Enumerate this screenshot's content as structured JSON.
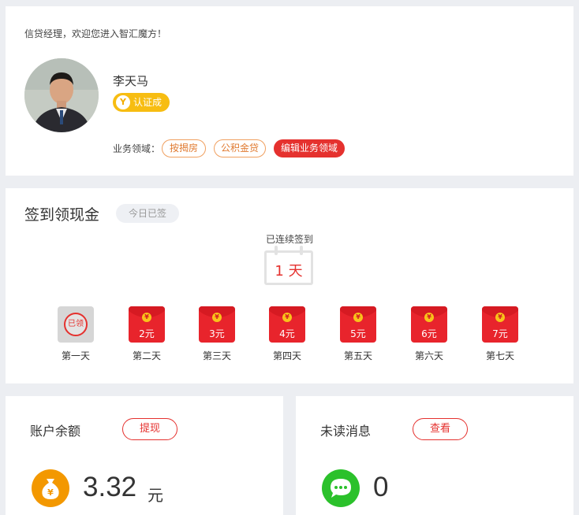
{
  "profile": {
    "welcome": "信贷经理，欢迎您进入智汇魔方！",
    "name": "李天马",
    "badge": "认证成",
    "field_label": "业务领域：",
    "tags": [
      "按揭房",
      "公积金贷"
    ],
    "edit_label": "编辑业务领域"
  },
  "signin": {
    "title": "签到领现金",
    "status": "今日已签",
    "streak_label": "已连续签到",
    "streak_value": "1 天",
    "stamp": "已领",
    "days": [
      {
        "label": "第一天",
        "amount": "",
        "claimed": true
      },
      {
        "label": "第二天",
        "amount": "2元",
        "claimed": false
      },
      {
        "label": "第三天",
        "amount": "3元",
        "claimed": false
      },
      {
        "label": "第四天",
        "amount": "4元",
        "claimed": false
      },
      {
        "label": "第五天",
        "amount": "5元",
        "claimed": false
      },
      {
        "label": "第六天",
        "amount": "6元",
        "claimed": false
      },
      {
        "label": "第七天",
        "amount": "7元",
        "claimed": false
      }
    ]
  },
  "balance": {
    "title": "账户余额",
    "button": "提现",
    "amount": "3.32",
    "unit": "元",
    "icon": "money-bag-icon",
    "icon_symbol": "¥",
    "icon_color": "#f39800"
  },
  "messages": {
    "title": "未读消息",
    "button": "查看",
    "count": "0",
    "icon": "chat-bubble-icon",
    "icon_color": "#2bc12b"
  },
  "colors": {
    "accent_red": "#e5312e",
    "badge_yellow": "#f7bd12",
    "envelope_red": "#e8242c"
  }
}
